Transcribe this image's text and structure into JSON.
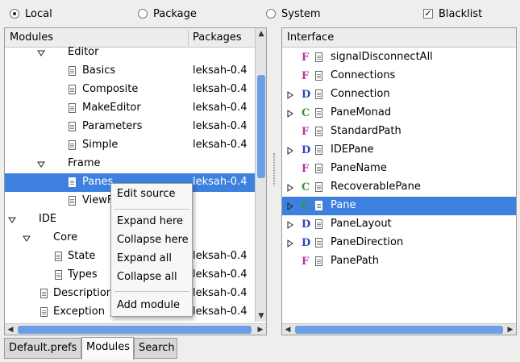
{
  "top_options": {
    "local": "Local",
    "package": "Package",
    "system": "System",
    "blacklist": "Blacklist"
  },
  "left": {
    "headers": {
      "modules": "Modules",
      "packages": "Packages"
    },
    "rows": [
      {
        "label": "Editor",
        "pkg": ""
      },
      {
        "label": "Basics",
        "pkg": "leksah-0.4"
      },
      {
        "label": "Composite",
        "pkg": "leksah-0.4"
      },
      {
        "label": "MakeEditor",
        "pkg": "leksah-0.4"
      },
      {
        "label": "Parameters",
        "pkg": "leksah-0.4"
      },
      {
        "label": "Simple",
        "pkg": "leksah-0.4"
      },
      {
        "label": "Frame",
        "pkg": ""
      },
      {
        "label": "Panes",
        "pkg": "leksah-0.4"
      },
      {
        "label": "ViewFrame",
        "pkg": ""
      },
      {
        "label": "IDE",
        "pkg": ""
      },
      {
        "label": "Core",
        "pkg": ""
      },
      {
        "label": "State",
        "pkg": "leksah-0.4"
      },
      {
        "label": "Types",
        "pkg": "leksah-0.4"
      },
      {
        "label": "Description",
        "pkg": "leksah-0.4"
      },
      {
        "label": "Exception",
        "pkg": "leksah-0.4"
      }
    ]
  },
  "right": {
    "header": "Interface",
    "items": [
      {
        "kind": "F",
        "label": "signalDisconnectAll"
      },
      {
        "kind": "F",
        "label": "Connections"
      },
      {
        "kind": "D",
        "label": "Connection"
      },
      {
        "kind": "C",
        "label": "PaneMonad"
      },
      {
        "kind": "F",
        "label": "StandardPath"
      },
      {
        "kind": "D",
        "label": "IDEPane"
      },
      {
        "kind": "F",
        "label": "PaneName"
      },
      {
        "kind": "C",
        "label": "RecoverablePane"
      },
      {
        "kind": "C",
        "label": "Pane"
      },
      {
        "kind": "D",
        "label": "PaneLayout"
      },
      {
        "kind": "D",
        "label": "PaneDirection"
      },
      {
        "kind": "F",
        "label": "PanePath"
      }
    ]
  },
  "context_menu": {
    "edit_source": "Edit source",
    "expand_here": "Expand here",
    "collapse_here": "Collapse here",
    "expand_all": "Expand all",
    "collapse_all": "Collapse all",
    "add_module": "Add module"
  },
  "tabs": {
    "default_prefs": "Default.prefs",
    "modules": "Modules",
    "search": "Search"
  },
  "colors": {
    "selection": "#3d80df",
    "kind_F": "#b0379b",
    "kind_D": "#3046b8",
    "kind_C": "#2a9a3a"
  }
}
